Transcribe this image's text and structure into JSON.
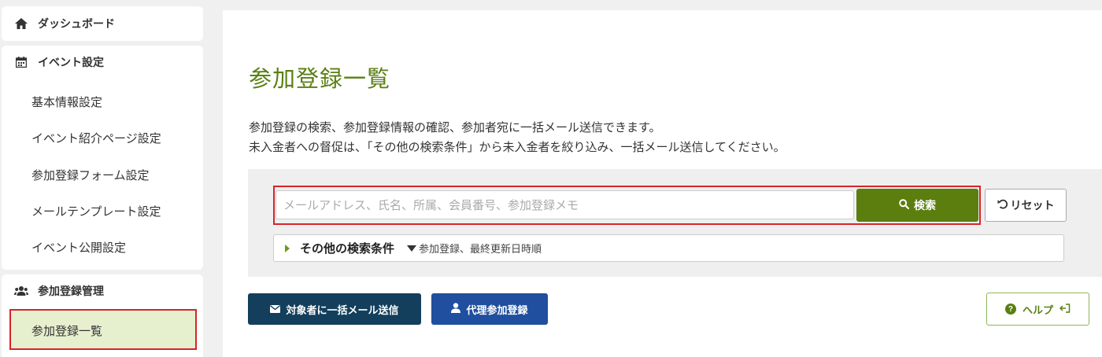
{
  "sidebar": {
    "dashboard": {
      "label": "ダッシュボード",
      "icon": "home-icon"
    },
    "event_settings": {
      "label": "イベント設定",
      "icon": "calendar-icon",
      "items": [
        {
          "label": "基本情報設定"
        },
        {
          "label": "イベント紹介ページ設定"
        },
        {
          "label": "参加登録フォーム設定"
        },
        {
          "label": "メールテンプレート設定"
        },
        {
          "label": "イベント公開設定"
        }
      ]
    },
    "registration": {
      "label": "参加登録管理",
      "icon": "users-icon",
      "items": [
        {
          "label": "参加登録一覧",
          "active": true
        }
      ]
    }
  },
  "main": {
    "title": "参加登録一覧",
    "description": [
      "参加登録の検索、参加登録情報の確認、参加者宛に一括メール送信できます。",
      "未入金者への督促は、「その他の検索条件」から未入金者を絞り込み、一括メール送信してください。"
    ],
    "search": {
      "placeholder": "メールアドレス、氏名、所属、会員番号、参加登録メモ",
      "value": "",
      "search_label": "検索",
      "reset_label": "リセット"
    },
    "more_conditions": {
      "label": "その他の検索条件",
      "sort_text": "参加登録、最終更新日時順"
    },
    "actions": {
      "bulk_mail_label": "対象者に一括メール送信",
      "proxy_register_label": "代理参加登録",
      "help_label": "ヘルプ"
    }
  },
  "colors": {
    "title_green": "#5a7f13",
    "search_button": "#5b7e0f",
    "mail_button": "#133f5c",
    "proxy_button": "#1f4f9e",
    "active_bg": "#e6f0cf",
    "highlight_red": "#d8232a"
  }
}
